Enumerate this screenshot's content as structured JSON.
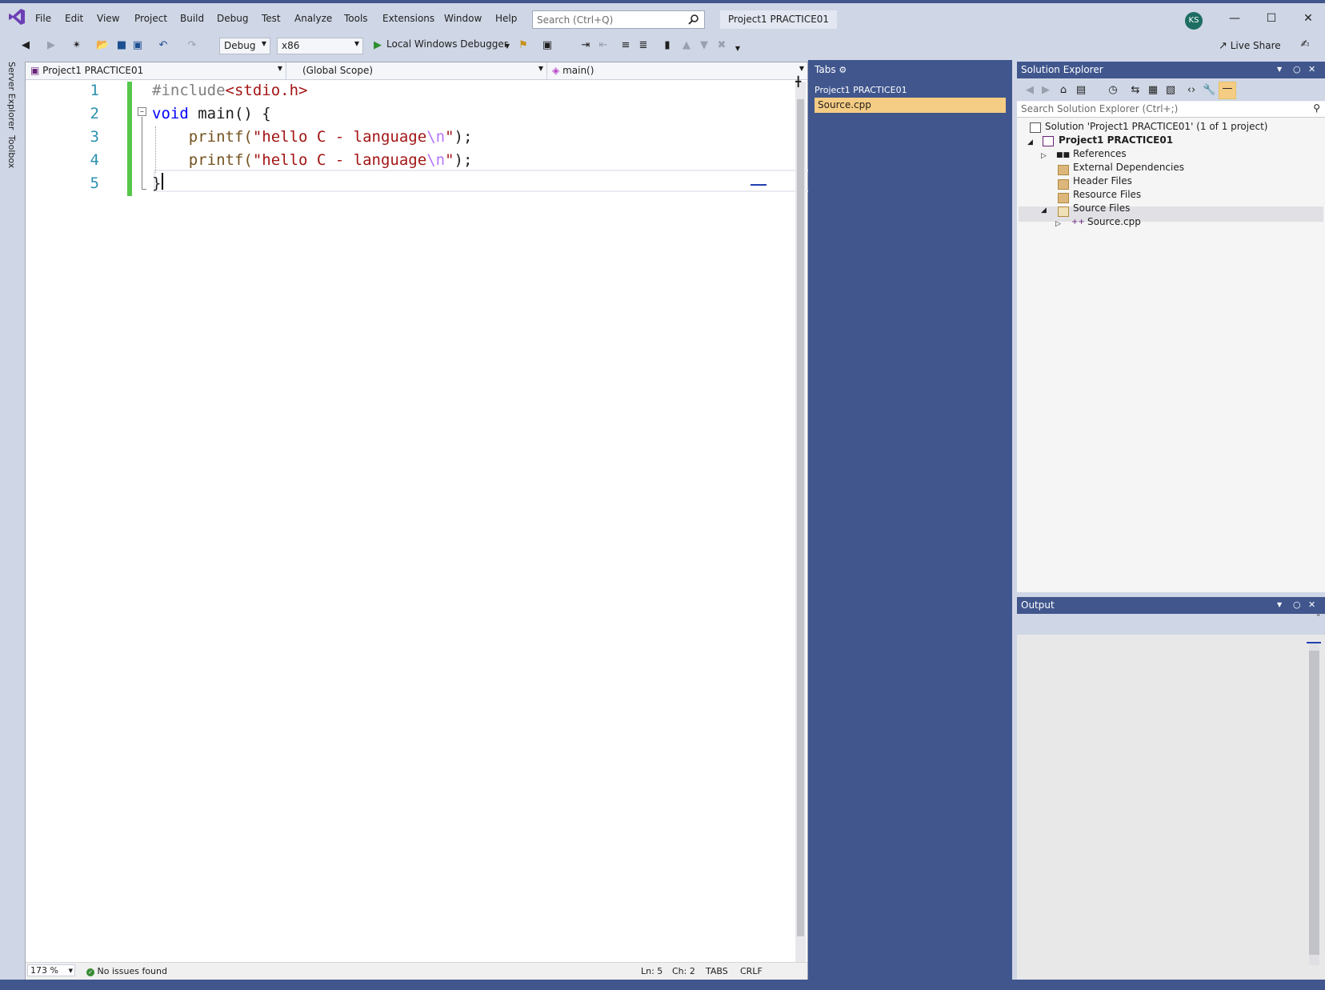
{
  "menu": {
    "items": [
      "File",
      "Edit",
      "View",
      "Project",
      "Build",
      "Debug",
      "Test",
      "Analyze",
      "Tools",
      "Extensions",
      "Window",
      "Help"
    ],
    "search_placeholder": "Search (Ctrl+Q)",
    "solution_name": "Project1 PRACTICE01",
    "user_initials": "KS"
  },
  "toolbar": {
    "config": "Debug",
    "platform": "x86",
    "debugger": "Local Windows Debugger",
    "live_share": "Live Share"
  },
  "left_dock": {
    "server_explorer": "Server Explorer",
    "toolbox": "Toolbox"
  },
  "editor": {
    "nav_project": "Project1 PRACTICE01",
    "nav_scope": "(Global Scope)",
    "nav_member": "main()",
    "line_numbers": [
      "1",
      "2",
      "3",
      "4",
      "5"
    ],
    "lines": [
      [
        {
          "t": "#include",
          "c": "pp"
        },
        {
          "t": "<stdio.h>",
          "c": "inc"
        }
      ],
      [
        {
          "t": "void",
          "c": "kw"
        },
        {
          "t": " main() {",
          "c": "pl"
        }
      ],
      [
        {
          "t": "    printf(",
          "c": "fn"
        },
        {
          "t": "\"hello C - language",
          "c": "str"
        },
        {
          "t": "\\n",
          "c": "esc"
        },
        {
          "t": "\"",
          "c": "str"
        },
        {
          "t": ");",
          "c": "pl"
        }
      ],
      [
        {
          "t": "    printf(",
          "c": "fn"
        },
        {
          "t": "\"hello C - language",
          "c": "str"
        },
        {
          "t": "\\n",
          "c": "esc"
        },
        {
          "t": "\"",
          "c": "str"
        },
        {
          "t": ");",
          "c": "pl"
        }
      ],
      [
        {
          "t": "}",
          "c": "pl"
        }
      ]
    ],
    "status": {
      "zoom": "173 %",
      "issues": "No issues found",
      "line": "Ln: 5",
      "col": "Ch: 2",
      "indent": "TABS",
      "eol": "CRLF"
    }
  },
  "tabs_panel": {
    "title": "Tabs",
    "project": "Project1 PRACTICE01",
    "file": "Source.cpp"
  },
  "solution_explorer": {
    "title": "Solution Explorer",
    "search_placeholder": "Search Solution Explorer (Ctrl+;)",
    "solution": "Solution 'Project1 PRACTICE01' (1 of 1 project)",
    "project": "Project1 PRACTICE01",
    "references": "References",
    "external_deps": "External Dependencies",
    "header_files": "Header Files",
    "resource_files": "Resource Files",
    "source_files": "Source Files",
    "source_cpp": "Source.cpp"
  },
  "output": {
    "title": "Output"
  }
}
